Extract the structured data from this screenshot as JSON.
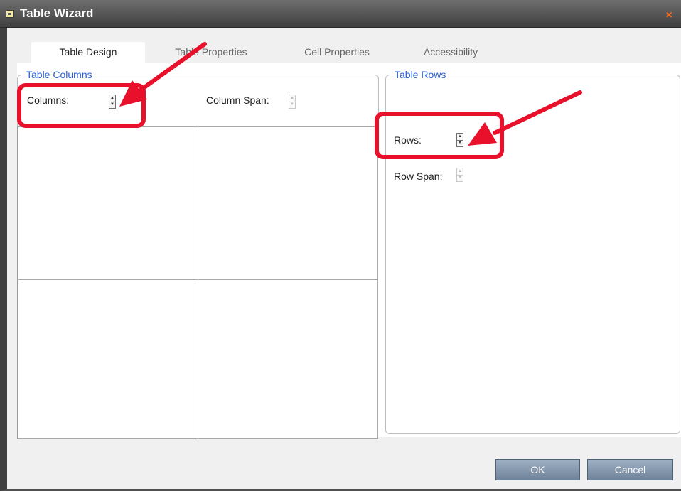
{
  "window": {
    "title": "Table Wizard",
    "close_label": "×"
  },
  "tabs": [
    {
      "label": "Table Design"
    },
    {
      "label": "Table Properties"
    },
    {
      "label": "Cell Properties"
    },
    {
      "label": "Accessibility"
    }
  ],
  "columns_group": {
    "legend": "Table Columns",
    "columns_label": "Columns:",
    "column_span_label": "Column Span:"
  },
  "rows_group": {
    "legend": "Table Rows",
    "rows_label": "Rows:",
    "row_span_label": "Row Span:"
  },
  "buttons": {
    "ok": "OK",
    "cancel": "Cancel"
  },
  "icons": {
    "title": "table-wizard-icon",
    "close": "close-icon",
    "spinner_up": "spinner-up-icon",
    "spinner_down": "spinner-down-icon"
  },
  "colors": {
    "titlebar": "#4a4a4a",
    "legend": "#2a5fd6",
    "highlight": "#e8102a",
    "close": "#ff6a1a"
  }
}
